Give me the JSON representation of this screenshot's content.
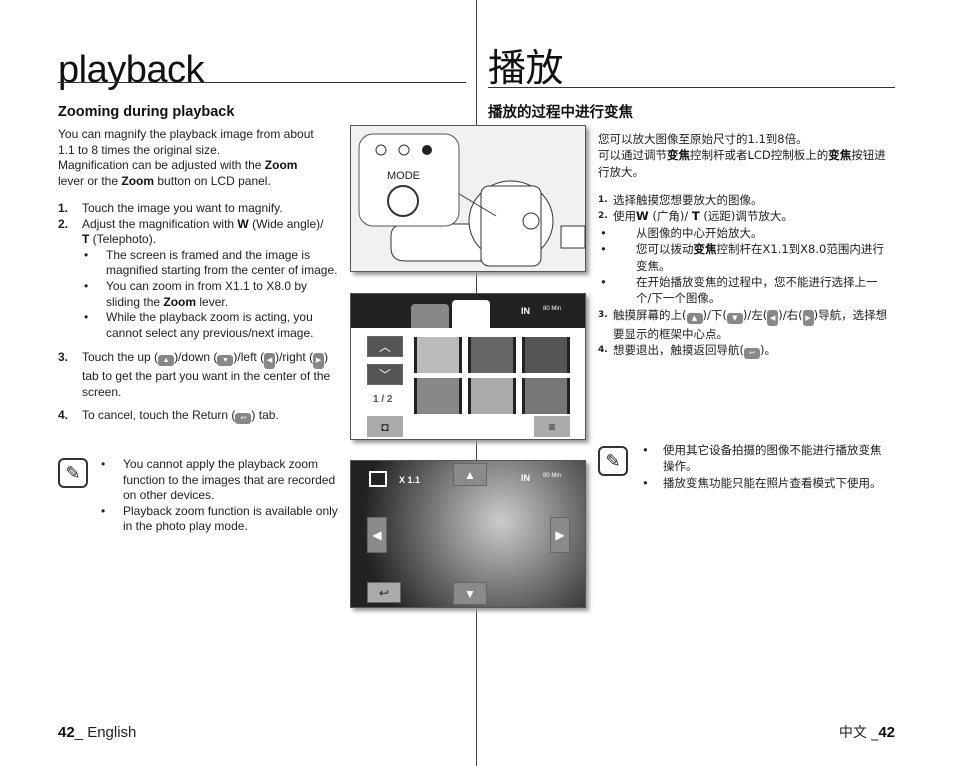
{
  "left": {
    "title": "playback",
    "heading": "Zooming during playback",
    "intro": [
      "You can magnify the playback image from about",
      "1.1 to 8 times the original size.",
      "Magnification can be adjusted with the ",
      "Zoom",
      "lever or the ",
      "Zoom",
      " button on LCD panel."
    ],
    "steps": {
      "s1": {
        "n": "1.",
        "t": "Touch the image you want to magnify."
      },
      "s2": {
        "n": "2.",
        "a": "Adjust the magnification with ",
        "w": "W",
        "b": " (Wide angle)/",
        "t": "T",
        "c": " (Telephoto).",
        "bullets": {
          "b1": "The screen is framed and the image is magnified starting from the center of image.",
          "b2a": "You can zoom in from X1.1 to X8.0 by sliding the ",
          "b2z": "Zoom",
          "b2b": " lever.",
          "b3": "While the playback zoom is acting, you cannot select any previous/next image."
        }
      },
      "s3": {
        "n": "3.",
        "a": "Touch the up (",
        "b": ")/down (",
        "c": ")/left (",
        "d": ")/right (",
        "e": ") tab to get the part you want in the center of the screen."
      },
      "s4": {
        "n": "4.",
        "a": "To cancel, touch the Return (",
        "b": ") tab."
      }
    },
    "notes": [
      "You cannot apply the playback zoom function to the images that are recorded on other devices.",
      "Playback zoom function is available only in the photo play mode."
    ],
    "footer_page": "42",
    "footer_lang": "_ English"
  },
  "right": {
    "title": "播放",
    "heading": "播放的过程中进行变焦",
    "intro1": "您可以放大图像至原始尺寸的1.1到8倍。",
    "intro2a": "可以通过调节",
    "intro2b": "变焦",
    "intro2c": "控制杆或者LCD控制板上的",
    "intro2d": "变焦",
    "intro2e": "按钮进行放大。",
    "s1": {
      "n": "1.",
      "t": "选择触摸您想要放大的图像。"
    },
    "s2": {
      "n": "2.",
      "a": "使用",
      "w": "W",
      "b": " (广角)/ ",
      "t": "T",
      "c": " (远距)调节放大。",
      "b1": "从图像的中心开始放大。",
      "b2a": "您可以拨动",
      "b2z": "变焦",
      "b2b": "控制杆在X1.1到X8.0范围内进行变焦。",
      "b3": "在开始播放变焦的过程中，您不能进行选择上一个/下一个图像。"
    },
    "s3": {
      "n": "3.",
      "a": "触摸屏幕的上(",
      "b": ")/下(",
      "c": ")/左(",
      "d": ")/右(",
      "e": ")导航，选择想要显示的框架中心点。"
    },
    "s4": {
      "n": "4.",
      "a": "想要退出，触摸返回导航(",
      "b": ")。"
    },
    "notes": [
      "使用其它设备拍摄的图像不能进行播放变焦操作。",
      "播放变焦功能只能在照片查看模式下使用。"
    ],
    "footer_lang": "中文 _",
    "footer_page": "42"
  },
  "figures": {
    "mode_label": "MODE",
    "page_indicator": "1 / 2",
    "zoom_level": "X 1.1",
    "storage": "IN",
    "battery": "80 Min"
  },
  "icons": {
    "up": "▲",
    "down": "▼",
    "left": "◀",
    "right": "▶",
    "return": "↩",
    "note": "note-pencil-icon"
  }
}
